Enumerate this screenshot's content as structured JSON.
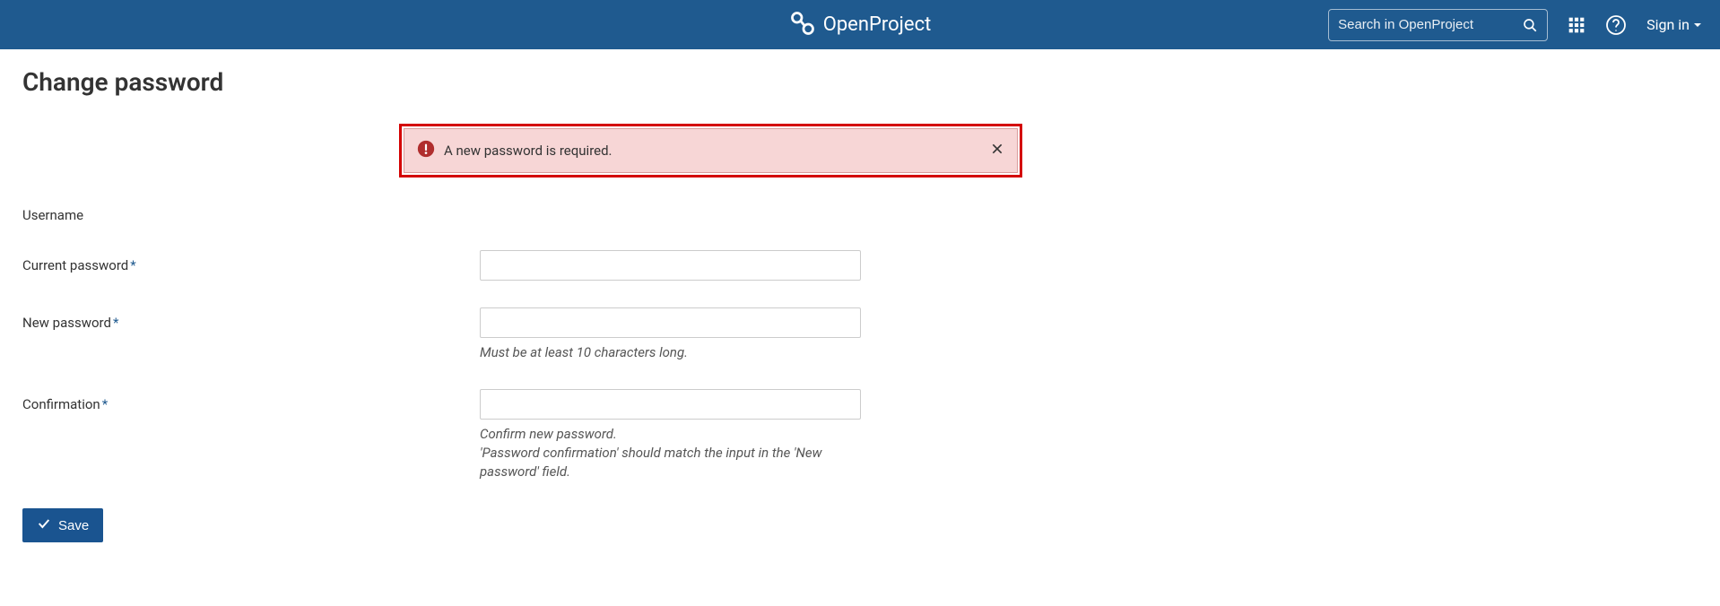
{
  "header": {
    "app_name": "OpenProject",
    "search_placeholder": "Search in OpenProject",
    "sign_in_label": "Sign in"
  },
  "page": {
    "title": "Change password"
  },
  "alert": {
    "message": "A new password is required."
  },
  "form": {
    "username": {
      "label": "Username",
      "value": ""
    },
    "current_password": {
      "label": "Current password",
      "required": true
    },
    "new_password": {
      "label": "New password",
      "required": true,
      "hint": "Must be at least 10 characters long."
    },
    "confirmation": {
      "label": "Confirmation",
      "required": true,
      "hint_line1": "Confirm new password.",
      "hint_line2": "'Password confirmation' should match the input in the 'New password' field."
    },
    "save_label": "Save"
  }
}
